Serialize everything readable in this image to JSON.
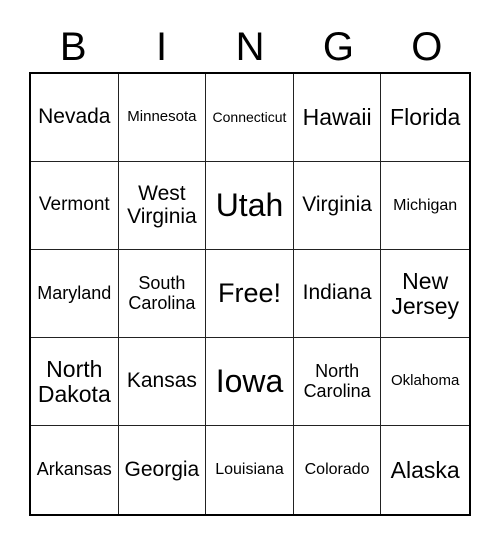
{
  "card": {
    "title": "BINGO Card",
    "header": {
      "letters": [
        "B",
        "I",
        "N",
        "G",
        "O"
      ]
    },
    "columns": 5,
    "rows": 5,
    "free_space": "Free!",
    "colors": {
      "background": "#ffffff",
      "text": "#000000",
      "grid_line": "#222222",
      "outer_border": "#000000"
    },
    "cells": [
      {
        "text": "Nevada",
        "size": "fs-l",
        "column": "B",
        "row": 1
      },
      {
        "text": "Minnesota",
        "size": "fs-s",
        "column": "I",
        "row": 1
      },
      {
        "text": "Connecticut",
        "size": "fs-xs",
        "column": "N",
        "row": 1
      },
      {
        "text": "Hawaii",
        "size": "fs-xl",
        "column": "G",
        "row": 1
      },
      {
        "text": "Florida",
        "size": "fs-xl",
        "column": "O",
        "row": 1
      },
      {
        "text": "Vermont",
        "size": "fs-ml",
        "column": "B",
        "row": 2
      },
      {
        "text": "West Virginia",
        "size": "fs-l",
        "column": "I",
        "row": 2
      },
      {
        "text": "Utah",
        "size": "fs-3xl",
        "column": "N",
        "row": 2
      },
      {
        "text": "Virginia",
        "size": "fs-l",
        "column": "G",
        "row": 2
      },
      {
        "text": "Michigan",
        "size": "fs-sm",
        "column": "O",
        "row": 2
      },
      {
        "text": "Maryland",
        "size": "fs-m",
        "column": "B",
        "row": 3
      },
      {
        "text": "South Carolina",
        "size": "fs-m",
        "column": "I",
        "row": 3
      },
      {
        "text": "Free!",
        "size": "fs-2xl",
        "column": "N",
        "row": 3
      },
      {
        "text": "Indiana",
        "size": "fs-l",
        "column": "G",
        "row": 3
      },
      {
        "text": "New Jersey",
        "size": "fs-xl",
        "column": "O",
        "row": 3
      },
      {
        "text": "North Dakota",
        "size": "fs-xl",
        "column": "B",
        "row": 4
      },
      {
        "text": "Kansas",
        "size": "fs-l",
        "column": "I",
        "row": 4
      },
      {
        "text": "Iowa",
        "size": "fs-3xl",
        "column": "N",
        "row": 4
      },
      {
        "text": "North Carolina",
        "size": "fs-m",
        "column": "G",
        "row": 4
      },
      {
        "text": "Oklahoma",
        "size": "fs-s",
        "column": "O",
        "row": 4
      },
      {
        "text": "Arkansas",
        "size": "fs-m",
        "column": "B",
        "row": 5
      },
      {
        "text": "Georgia",
        "size": "fs-l",
        "column": "I",
        "row": 5
      },
      {
        "text": "Louisiana",
        "size": "fs-sm",
        "column": "N",
        "row": 5
      },
      {
        "text": "Colorado",
        "size": "fs-sm",
        "column": "G",
        "row": 5
      },
      {
        "text": "Alaska",
        "size": "fs-xl",
        "column": "O",
        "row": 5
      }
    ]
  }
}
